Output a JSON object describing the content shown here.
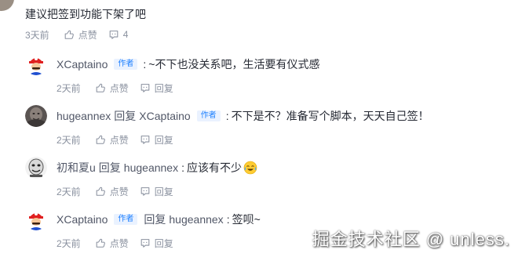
{
  "root": {
    "text": "建议把签到功能下架了吧",
    "time": "3天前",
    "like_label": "点赞",
    "comment_count": "4"
  },
  "replies": [
    {
      "author": "XCaptaino",
      "badge": "作者",
      "reply_word": "",
      "target": "",
      "target_badge": "",
      "separator": ":",
      "content": "~不下也没关系吧，生活要有仪式感",
      "time": "2天前",
      "like_label": "点赞",
      "reply_label": "回复"
    },
    {
      "author": "hugeannex",
      "badge": "",
      "reply_word": "回复",
      "target": "XCaptaino",
      "target_badge": "作者",
      "separator": ":",
      "content": "不下是不？准备写个脚本，天天自己签！",
      "time": "2天前",
      "like_label": "点赞",
      "reply_label": "回复"
    },
    {
      "author": "初和夏u",
      "badge": "",
      "reply_word": "回复",
      "target": "hugeannex",
      "target_badge": "",
      "separator": ":",
      "content": "应该有不少",
      "time": "2天前",
      "like_label": "点赞",
      "reply_label": "回复"
    },
    {
      "author": "XCaptaino",
      "badge": "作者",
      "reply_word": "回复",
      "target": "hugeannex",
      "target_badge": "",
      "separator": ":",
      "content": "签呗~",
      "time": "2天前",
      "like_label": "点赞",
      "reply_label": "回复"
    }
  ],
  "watermark": "掘金技术社区 @ unless.",
  "colors": {
    "text": "#252933",
    "secondary": "#8a919f",
    "badge_text": "#1e80ff",
    "badge_bg": "#eaf2ff"
  }
}
